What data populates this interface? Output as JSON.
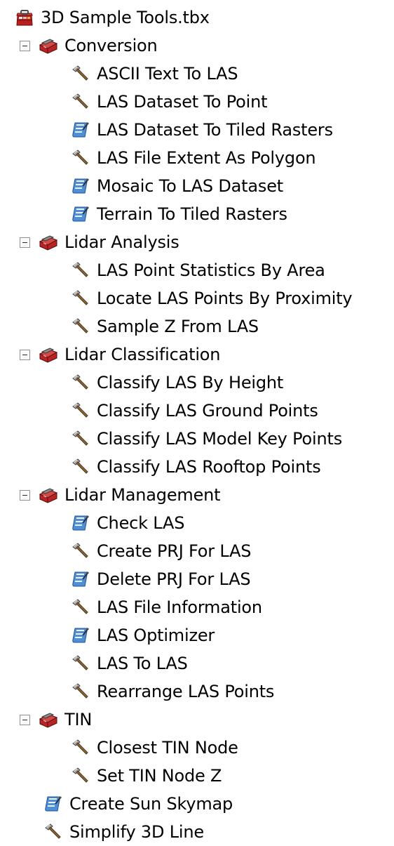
{
  "toolbox": {
    "name": "3D Sample Tools.tbx",
    "icon": "toolbox-icon"
  },
  "toolsets": [
    {
      "name": "Conversion",
      "icon": "toolset-icon",
      "expanded": true,
      "tools": [
        {
          "name": "ASCII Text To LAS",
          "icon": "hammer-tool-icon"
        },
        {
          "name": "LAS Dataset To Point",
          "icon": "hammer-tool-icon"
        },
        {
          "name": "LAS Dataset To Tiled Rasters",
          "icon": "script-tool-icon"
        },
        {
          "name": "LAS File Extent As Polygon",
          "icon": "hammer-tool-icon"
        },
        {
          "name": "Mosaic To LAS Dataset",
          "icon": "script-tool-icon"
        },
        {
          "name": "Terrain To Tiled Rasters",
          "icon": "script-tool-icon"
        }
      ]
    },
    {
      "name": "Lidar Analysis",
      "icon": "toolset-icon",
      "expanded": true,
      "tools": [
        {
          "name": "LAS Point Statistics By Area",
          "icon": "hammer-tool-icon"
        },
        {
          "name": "Locate LAS Points By Proximity",
          "icon": "hammer-tool-icon"
        },
        {
          "name": "Sample Z From LAS",
          "icon": "hammer-tool-icon"
        }
      ]
    },
    {
      "name": "Lidar Classification",
      "icon": "toolset-icon",
      "expanded": true,
      "tools": [
        {
          "name": "Classify LAS By Height",
          "icon": "hammer-tool-icon"
        },
        {
          "name": "Classify LAS Ground Points",
          "icon": "hammer-tool-icon"
        },
        {
          "name": "Classify LAS Model Key Points",
          "icon": "hammer-tool-icon"
        },
        {
          "name": "Classify LAS Rooftop Points",
          "icon": "hammer-tool-icon"
        }
      ]
    },
    {
      "name": "Lidar Management",
      "icon": "toolset-icon",
      "expanded": true,
      "tools": [
        {
          "name": "Check LAS",
          "icon": "script-tool-icon"
        },
        {
          "name": "Create PRJ For LAS",
          "icon": "hammer-tool-icon"
        },
        {
          "name": "Delete PRJ For LAS",
          "icon": "script-tool-icon"
        },
        {
          "name": "LAS File Information",
          "icon": "hammer-tool-icon"
        },
        {
          "name": "LAS Optimizer",
          "icon": "script-tool-icon"
        },
        {
          "name": "LAS To LAS",
          "icon": "hammer-tool-icon"
        },
        {
          "name": "Rearrange LAS Points",
          "icon": "hammer-tool-icon"
        }
      ]
    },
    {
      "name": "TIN",
      "icon": "toolset-icon",
      "expanded": true,
      "tools": [
        {
          "name": "Closest TIN Node",
          "icon": "hammer-tool-icon"
        },
        {
          "name": "Set TIN Node Z",
          "icon": "hammer-tool-icon"
        }
      ]
    }
  ],
  "root_tools": [
    {
      "name": "Create Sun Skymap",
      "icon": "script-tool-icon"
    },
    {
      "name": "Simplify 3D Line",
      "icon": "hammer-tool-icon"
    }
  ]
}
